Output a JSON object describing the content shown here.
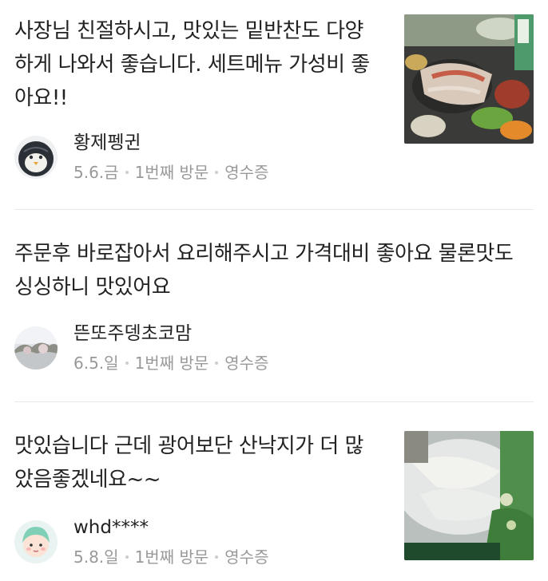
{
  "reviews": [
    {
      "text": "사장님 친절하시고, 맛있는 밑반찬도 다양하게 나와서 좋습니다. 세트메뉴 가성비 좋아요!!",
      "author": "황제펭귄",
      "date": "5.6.금",
      "visit": "1번째 방문",
      "receipt": "영수증"
    },
    {
      "text": "주문후 바로잡아서 요리해주시고 가격대비 좋아요 물론맛도 싱싱하니 맛있어요",
      "author": "뜬또주뎅초코맘",
      "date": "6.5.일",
      "visit": "1번째 방문",
      "receipt": "영수증"
    },
    {
      "text": "맛있습니다 근데 광어보단 산낙지가 더 많았음좋겠네요~~",
      "author": "whd****",
      "date": "5.8.일",
      "visit": "1번째 방문",
      "receipt": "영수증"
    }
  ]
}
